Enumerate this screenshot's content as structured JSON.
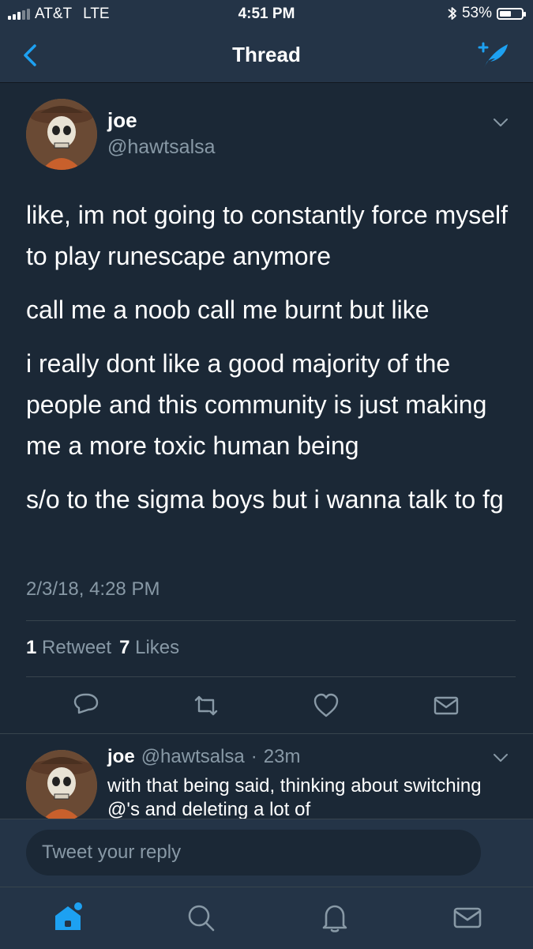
{
  "status_bar": {
    "carrier": "AT&T",
    "network": "LTE",
    "time": "4:51 PM",
    "battery": "53%",
    "battery_level": 0.53
  },
  "nav": {
    "title": "Thread",
    "back_icon": "chevron-left-icon",
    "compose_icon": "compose-tweet-icon"
  },
  "tweet": {
    "display_name": "joe",
    "handle": "@hawtsalsa",
    "paragraphs": [
      "like, im not going to constantly force myself to play runescape anymore",
      "call me a noob call me burnt but like",
      "i really dont like a good majority of the people and this community is just making me a more toxic human being",
      "s/o to the sigma boys but i wanna talk to fg"
    ],
    "timestamp": "2/3/18, 4:28 PM",
    "retweet_count": "1",
    "retweet_label": "Retweet",
    "like_count": "7",
    "like_label": "Likes"
  },
  "reply_tweet": {
    "display_name": "joe",
    "handle": "@hawtsalsa",
    "separator": "·",
    "time": "23m",
    "text": "with that being said, thinking about switching @'s and deleting a lot of"
  },
  "reply_bar": {
    "placeholder": "Tweet your reply"
  },
  "tab_bar": {
    "items": [
      "home-icon",
      "search-icon",
      "notifications-icon",
      "messages-icon"
    ]
  },
  "colors": {
    "background": "#1b2836",
    "bar": "#243447",
    "accent": "#1da1f2",
    "muted": "#8899a6"
  }
}
